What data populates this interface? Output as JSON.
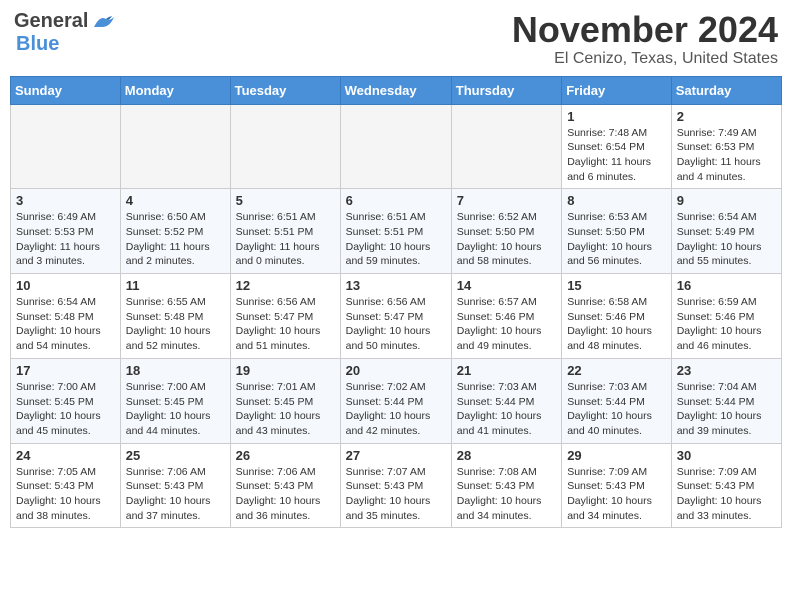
{
  "header": {
    "logo_general": "General",
    "logo_blue": "Blue",
    "month_title": "November 2024",
    "location": "El Cenizo, Texas, United States"
  },
  "weekdays": [
    "Sunday",
    "Monday",
    "Tuesday",
    "Wednesday",
    "Thursday",
    "Friday",
    "Saturday"
  ],
  "weeks": [
    {
      "days": [
        {
          "number": "",
          "empty": true
        },
        {
          "number": "",
          "empty": true
        },
        {
          "number": "",
          "empty": true
        },
        {
          "number": "",
          "empty": true
        },
        {
          "number": "",
          "empty": true
        },
        {
          "number": "1",
          "sunrise": "Sunrise: 7:48 AM",
          "sunset": "Sunset: 6:54 PM",
          "daylight": "Daylight: 11 hours and 6 minutes."
        },
        {
          "number": "2",
          "sunrise": "Sunrise: 7:49 AM",
          "sunset": "Sunset: 6:53 PM",
          "daylight": "Daylight: 11 hours and 4 minutes."
        }
      ]
    },
    {
      "days": [
        {
          "number": "3",
          "sunrise": "Sunrise: 6:49 AM",
          "sunset": "Sunset: 5:53 PM",
          "daylight": "Daylight: 11 hours and 3 minutes."
        },
        {
          "number": "4",
          "sunrise": "Sunrise: 6:50 AM",
          "sunset": "Sunset: 5:52 PM",
          "daylight": "Daylight: 11 hours and 2 minutes."
        },
        {
          "number": "5",
          "sunrise": "Sunrise: 6:51 AM",
          "sunset": "Sunset: 5:51 PM",
          "daylight": "Daylight: 11 hours and 0 minutes."
        },
        {
          "number": "6",
          "sunrise": "Sunrise: 6:51 AM",
          "sunset": "Sunset: 5:51 PM",
          "daylight": "Daylight: 10 hours and 59 minutes."
        },
        {
          "number": "7",
          "sunrise": "Sunrise: 6:52 AM",
          "sunset": "Sunset: 5:50 PM",
          "daylight": "Daylight: 10 hours and 58 minutes."
        },
        {
          "number": "8",
          "sunrise": "Sunrise: 6:53 AM",
          "sunset": "Sunset: 5:50 PM",
          "daylight": "Daylight: 10 hours and 56 minutes."
        },
        {
          "number": "9",
          "sunrise": "Sunrise: 6:54 AM",
          "sunset": "Sunset: 5:49 PM",
          "daylight": "Daylight: 10 hours and 55 minutes."
        }
      ]
    },
    {
      "days": [
        {
          "number": "10",
          "sunrise": "Sunrise: 6:54 AM",
          "sunset": "Sunset: 5:48 PM",
          "daylight": "Daylight: 10 hours and 54 minutes."
        },
        {
          "number": "11",
          "sunrise": "Sunrise: 6:55 AM",
          "sunset": "Sunset: 5:48 PM",
          "daylight": "Daylight: 10 hours and 52 minutes."
        },
        {
          "number": "12",
          "sunrise": "Sunrise: 6:56 AM",
          "sunset": "Sunset: 5:47 PM",
          "daylight": "Daylight: 10 hours and 51 minutes."
        },
        {
          "number": "13",
          "sunrise": "Sunrise: 6:56 AM",
          "sunset": "Sunset: 5:47 PM",
          "daylight": "Daylight: 10 hours and 50 minutes."
        },
        {
          "number": "14",
          "sunrise": "Sunrise: 6:57 AM",
          "sunset": "Sunset: 5:46 PM",
          "daylight": "Daylight: 10 hours and 49 minutes."
        },
        {
          "number": "15",
          "sunrise": "Sunrise: 6:58 AM",
          "sunset": "Sunset: 5:46 PM",
          "daylight": "Daylight: 10 hours and 48 minutes."
        },
        {
          "number": "16",
          "sunrise": "Sunrise: 6:59 AM",
          "sunset": "Sunset: 5:46 PM",
          "daylight": "Daylight: 10 hours and 46 minutes."
        }
      ]
    },
    {
      "days": [
        {
          "number": "17",
          "sunrise": "Sunrise: 7:00 AM",
          "sunset": "Sunset: 5:45 PM",
          "daylight": "Daylight: 10 hours and 45 minutes."
        },
        {
          "number": "18",
          "sunrise": "Sunrise: 7:00 AM",
          "sunset": "Sunset: 5:45 PM",
          "daylight": "Daylight: 10 hours and 44 minutes."
        },
        {
          "number": "19",
          "sunrise": "Sunrise: 7:01 AM",
          "sunset": "Sunset: 5:45 PM",
          "daylight": "Daylight: 10 hours and 43 minutes."
        },
        {
          "number": "20",
          "sunrise": "Sunrise: 7:02 AM",
          "sunset": "Sunset: 5:44 PM",
          "daylight": "Daylight: 10 hours and 42 minutes."
        },
        {
          "number": "21",
          "sunrise": "Sunrise: 7:03 AM",
          "sunset": "Sunset: 5:44 PM",
          "daylight": "Daylight: 10 hours and 41 minutes."
        },
        {
          "number": "22",
          "sunrise": "Sunrise: 7:03 AM",
          "sunset": "Sunset: 5:44 PM",
          "daylight": "Daylight: 10 hours and 40 minutes."
        },
        {
          "number": "23",
          "sunrise": "Sunrise: 7:04 AM",
          "sunset": "Sunset: 5:44 PM",
          "daylight": "Daylight: 10 hours and 39 minutes."
        }
      ]
    },
    {
      "days": [
        {
          "number": "24",
          "sunrise": "Sunrise: 7:05 AM",
          "sunset": "Sunset: 5:43 PM",
          "daylight": "Daylight: 10 hours and 38 minutes."
        },
        {
          "number": "25",
          "sunrise": "Sunrise: 7:06 AM",
          "sunset": "Sunset: 5:43 PM",
          "daylight": "Daylight: 10 hours and 37 minutes."
        },
        {
          "number": "26",
          "sunrise": "Sunrise: 7:06 AM",
          "sunset": "Sunset: 5:43 PM",
          "daylight": "Daylight: 10 hours and 36 minutes."
        },
        {
          "number": "27",
          "sunrise": "Sunrise: 7:07 AM",
          "sunset": "Sunset: 5:43 PM",
          "daylight": "Daylight: 10 hours and 35 minutes."
        },
        {
          "number": "28",
          "sunrise": "Sunrise: 7:08 AM",
          "sunset": "Sunset: 5:43 PM",
          "daylight": "Daylight: 10 hours and 34 minutes."
        },
        {
          "number": "29",
          "sunrise": "Sunrise: 7:09 AM",
          "sunset": "Sunset: 5:43 PM",
          "daylight": "Daylight: 10 hours and 34 minutes."
        },
        {
          "number": "30",
          "sunrise": "Sunrise: 7:09 AM",
          "sunset": "Sunset: 5:43 PM",
          "daylight": "Daylight: 10 hours and 33 minutes."
        }
      ]
    }
  ]
}
